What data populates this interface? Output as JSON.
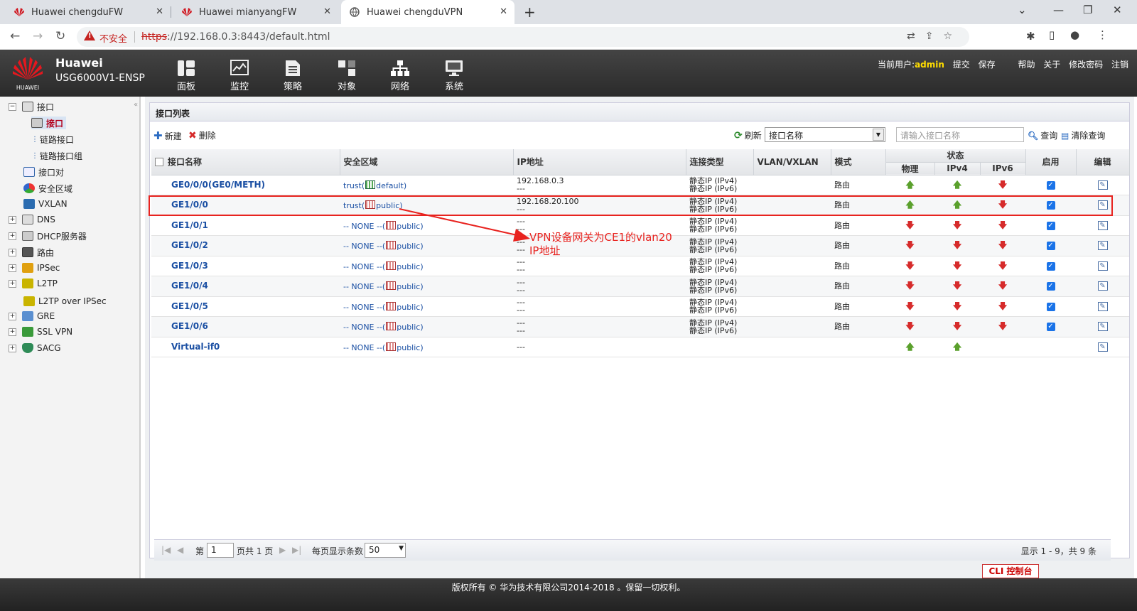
{
  "browser": {
    "tabs": [
      {
        "title": "Huawei chengduFW"
      },
      {
        "title": "Huawei mianyangFW"
      },
      {
        "title": "Huawei chengduVPN"
      }
    ],
    "insecure_label": "不安全",
    "url_scheme": "https",
    "url_rest": "://192.168.0.3:8443/default.html"
  },
  "header": {
    "brand": "Huawei",
    "model": "USG6000V1-ENSP",
    "logo_text": "HUAWEI",
    "menu": [
      "面板",
      "监控",
      "策略",
      "对象",
      "网络",
      "系统"
    ],
    "current_user_label": "当前用户:",
    "user": "admin",
    "actions": [
      "提交",
      "保存",
      "帮助",
      "关于",
      "修改密码",
      "注销"
    ]
  },
  "sidebar": {
    "items": [
      {
        "label": "接口",
        "level": 0,
        "expander": "−"
      },
      {
        "label": "接口",
        "level": 1,
        "active": true
      },
      {
        "label": "链路接口",
        "level": 1
      },
      {
        "label": "链路接口组",
        "level": 1
      },
      {
        "label": "接口对",
        "level": 0
      },
      {
        "label": "安全区域",
        "level": 0
      },
      {
        "label": "VXLAN",
        "level": 0
      },
      {
        "label": "DNS",
        "level": 0,
        "expander": "+"
      },
      {
        "label": "DHCP服务器",
        "level": 0,
        "expander": "+"
      },
      {
        "label": "路由",
        "level": 0,
        "expander": "+"
      },
      {
        "label": "IPSec",
        "level": 0,
        "expander": "+"
      },
      {
        "label": "L2TP",
        "level": 0,
        "expander": "+"
      },
      {
        "label": "L2TP over IPSec",
        "level": 0
      },
      {
        "label": "GRE",
        "level": 0,
        "expander": "+"
      },
      {
        "label": "SSL VPN",
        "level": 0,
        "expander": "+"
      },
      {
        "label": "SACG",
        "level": 0,
        "expander": "+"
      }
    ]
  },
  "panel": {
    "title": "接口列表",
    "new_label": "新建",
    "delete_label": "删除",
    "refresh_label": "刷新",
    "search_field": "接口名称",
    "search_placeholder": "请输入接口名称",
    "query_label": "查询",
    "clear_label": "清除查询"
  },
  "table": {
    "headers": {
      "name": "接口名称",
      "zone": "安全区域",
      "ip": "IP地址",
      "conn": "连接类型",
      "vlan": "VLAN/VXLAN",
      "mode": "模式",
      "status": "状态",
      "phys": "物理",
      "ipv4": "IPv4",
      "ipv6": "IPv6",
      "enable": "启用",
      "edit": "编辑"
    },
    "rows": [
      {
        "name": "GE0/0/0(GE0/METH)",
        "zone_prefix": "trust(",
        "zone_vsys": "default)",
        "zone_icon": "green",
        "ip1": "192.168.0.3",
        "ip2": "---",
        "conn1": "静态IP (IPv4)",
        "conn2": "静态IP (IPv6)",
        "mode": "路由",
        "phys": "up",
        "ipv4": "up",
        "ipv6": "down",
        "enabled": true
      },
      {
        "name": "GE1/0/0",
        "zone_prefix": "trust(",
        "zone_vsys": "public)",
        "zone_icon": "red",
        "ip1": "192.168.20.100",
        "ip2": "---",
        "conn1": "静态IP (IPv4)",
        "conn2": "静态IP (IPv6)",
        "mode": "路由",
        "phys": "up",
        "ipv4": "up",
        "ipv6": "down",
        "enabled": true
      },
      {
        "name": "GE1/0/1",
        "zone_prefix": "-- NONE --(",
        "zone_vsys": "public)",
        "zone_icon": "red",
        "ip1": "---",
        "ip2": "---",
        "conn1": "静态IP (IPv4)",
        "conn2": "静态IP (IPv6)",
        "mode": "路由",
        "phys": "down",
        "ipv4": "down",
        "ipv6": "down",
        "enabled": true
      },
      {
        "name": "GE1/0/2",
        "zone_prefix": "-- NONE --(",
        "zone_vsys": "public)",
        "zone_icon": "red",
        "ip1": "---",
        "ip2": "---",
        "conn1": "静态IP (IPv4)",
        "conn2": "静态IP (IPv6)",
        "mode": "路由",
        "phys": "down",
        "ipv4": "down",
        "ipv6": "down",
        "enabled": true
      },
      {
        "name": "GE1/0/3",
        "zone_prefix": "-- NONE --(",
        "zone_vsys": "public)",
        "zone_icon": "red",
        "ip1": "---",
        "ip2": "---",
        "conn1": "静态IP (IPv4)",
        "conn2": "静态IP (IPv6)",
        "mode": "路由",
        "phys": "down",
        "ipv4": "down",
        "ipv6": "down",
        "enabled": true
      },
      {
        "name": "GE1/0/4",
        "zone_prefix": "-- NONE --(",
        "zone_vsys": "public)",
        "zone_icon": "red",
        "ip1": "---",
        "ip2": "---",
        "conn1": "静态IP (IPv4)",
        "conn2": "静态IP (IPv6)",
        "mode": "路由",
        "phys": "down",
        "ipv4": "down",
        "ipv6": "down",
        "enabled": true
      },
      {
        "name": "GE1/0/5",
        "zone_prefix": "-- NONE --(",
        "zone_vsys": "public)",
        "zone_icon": "red",
        "ip1": "---",
        "ip2": "---",
        "conn1": "静态IP (IPv4)",
        "conn2": "静态IP (IPv6)",
        "mode": "路由",
        "phys": "down",
        "ipv4": "down",
        "ipv6": "down",
        "enabled": true
      },
      {
        "name": "GE1/0/6",
        "zone_prefix": "-- NONE --(",
        "zone_vsys": "public)",
        "zone_icon": "red",
        "ip1": "---",
        "ip2": "---",
        "conn1": "静态IP (IPv4)",
        "conn2": "静态IP (IPv6)",
        "mode": "路由",
        "phys": "down",
        "ipv4": "down",
        "ipv6": "down",
        "enabled": true
      },
      {
        "name": "Virtual-if0",
        "zone_prefix": "-- NONE --(",
        "zone_vsys": "public)",
        "zone_icon": "red",
        "ip1": "---",
        "ip2": "",
        "conn1": "",
        "conn2": "",
        "mode": "",
        "phys": "up",
        "ipv4": "up",
        "ipv6": "",
        "enabled": false
      }
    ]
  },
  "annotation": {
    "line1": "VPN设备网关为CE1的vlan20",
    "line2": "IP地址",
    "color": "#e8231f"
  },
  "pager": {
    "page_prefix": "第",
    "page_value": "1",
    "page_suffix": "页共 1 页",
    "per_page_label": "每页显示条数",
    "per_page_value": "50",
    "display_info": "显示 1 - 9，共 9 条"
  },
  "cli_label": "CLI 控制台",
  "footer": "版权所有 © 华为技术有限公司2014-2018 。保留一切权利。"
}
